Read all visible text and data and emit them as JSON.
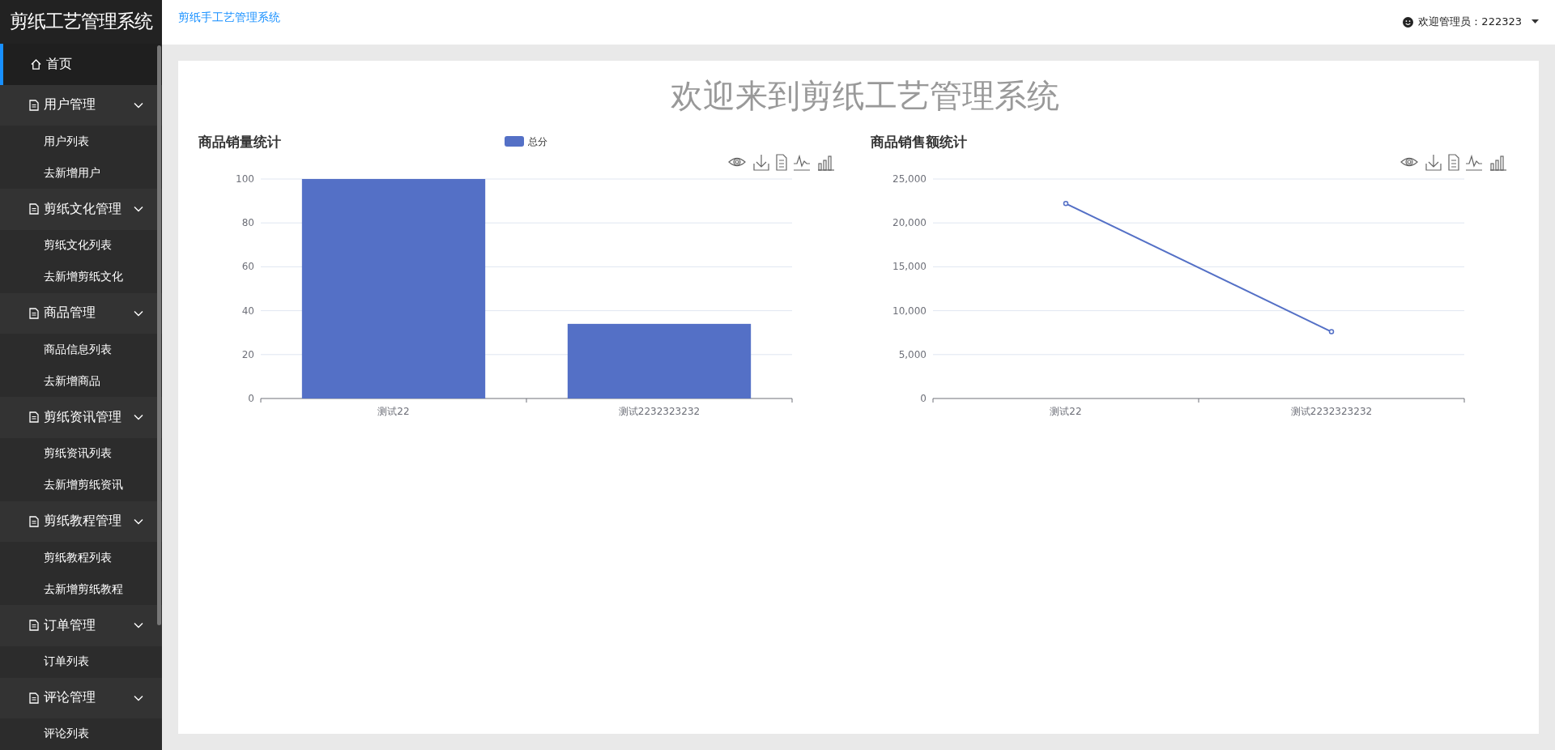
{
  "sidebar": {
    "logo": "剪纸工艺管理系统",
    "home": {
      "label": "首页",
      "selected": true
    },
    "groups": [
      {
        "label": "用户管理",
        "expanded": true,
        "children": [
          {
            "label": "用户列表",
            "selected": false
          },
          {
            "label": "去新增用户",
            "selected": false
          }
        ]
      },
      {
        "label": "剪纸文化管理",
        "expanded": true,
        "children": [
          {
            "label": "剪纸文化列表",
            "selected": false
          },
          {
            "label": "去新增剪纸文化",
            "selected": false
          }
        ]
      },
      {
        "label": "商品管理",
        "expanded": true,
        "children": [
          {
            "label": "商品信息列表",
            "selected": false
          },
          {
            "label": "去新增商品",
            "selected": false
          }
        ]
      },
      {
        "label": "剪纸资讯管理",
        "expanded": true,
        "children": [
          {
            "label": "剪纸资讯列表",
            "selected": false
          },
          {
            "label": "去新增剪纸资讯",
            "selected": false
          }
        ]
      },
      {
        "label": "剪纸教程管理",
        "expanded": true,
        "children": [
          {
            "label": "剪纸教程列表",
            "selected": false
          },
          {
            "label": "去新增剪纸教程",
            "selected": false
          }
        ]
      },
      {
        "label": "订单管理",
        "expanded": true,
        "children": [
          {
            "label": "订单列表",
            "selected": false
          }
        ]
      },
      {
        "label": "评论管理",
        "expanded": true,
        "children": [
          {
            "label": "评论列表",
            "selected": false
          }
        ]
      }
    ]
  },
  "header": {
    "breadcrumb": "剪纸手工艺管理系统",
    "user": "欢迎管理员：222323"
  },
  "welcome": "欢迎来到剪纸工艺管理系统",
  "charts": [
    {
      "chart_data": {
        "type": "bar",
        "title": "商品销量统计",
        "categories": [
          "测试22",
          "测试2232323232"
        ],
        "series": [
          {
            "name": "总分",
            "color": "#5470c6",
            "values": [
              100,
              34
            ]
          }
        ],
        "ylim": [
          0,
          100
        ],
        "yticks": [
          0,
          20,
          40,
          60,
          80,
          100
        ],
        "grid": true
      }
    },
    {
      "chart_data": {
        "type": "line",
        "title": "商品销售额统计",
        "categories": [
          "测试22",
          "测试2232323232"
        ],
        "series": [
          {
            "color": "#5470c6",
            "values": [
              22200,
              7600
            ],
            "marker": true
          }
        ],
        "grid": true,
        "ylim": [
          0,
          25000
        ],
        "yticks": [
          {
            "value": 0,
            "label": "0"
          },
          {
            "value": 5000,
            "label": "5,000"
          },
          {
            "value": 10000,
            "label": "10,000"
          },
          {
            "value": 15000,
            "label": "15,000"
          },
          {
            "value": 20000,
            "label": "20,000"
          },
          {
            "value": 25000,
            "label": "25,000"
          }
        ]
      }
    }
  ]
}
